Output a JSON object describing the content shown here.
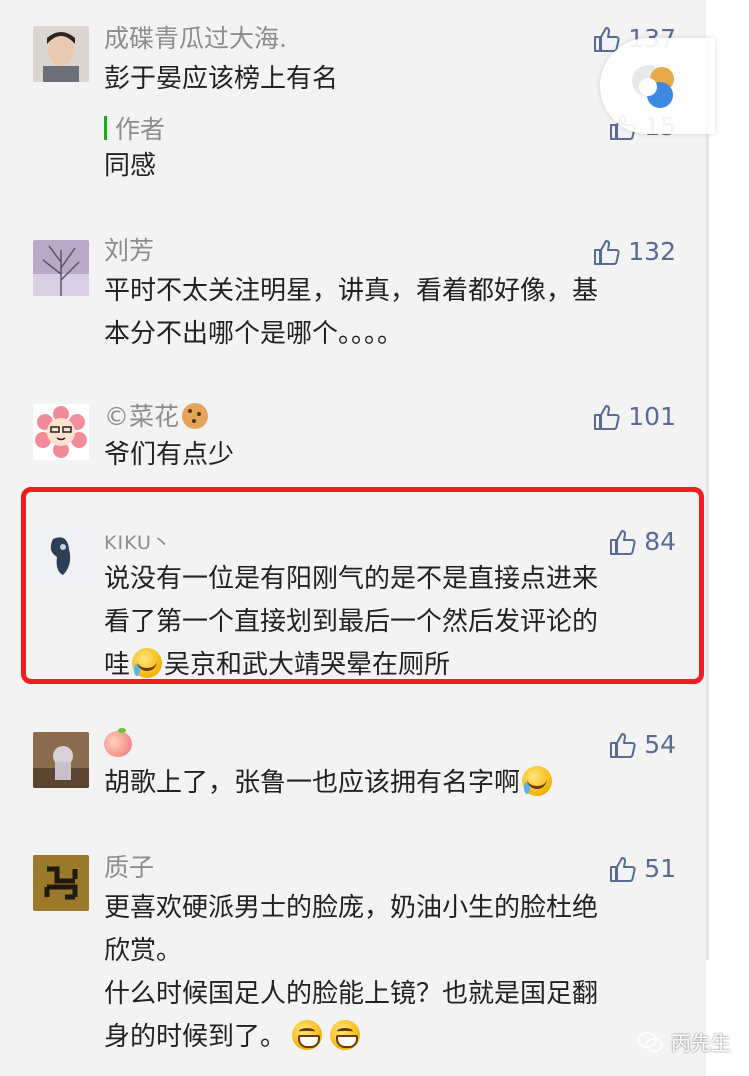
{
  "comments": [
    {
      "name": "成碟青瓜过大海.",
      "likes": "137",
      "lines": [
        "彭于晏应该榜上有名"
      ],
      "reply": {
        "author_label": "作者",
        "likes": "15",
        "text": "同感"
      }
    },
    {
      "name": "刘芳",
      "likes": "132",
      "lines": [
        "平时不太关注明星，讲真，看着都好像，基",
        "本分不出哪个是哪个。。。。"
      ]
    },
    {
      "name": "©菜花",
      "likes": "101",
      "lines": [
        "爷们有点少"
      ]
    },
    {
      "name": "KIKU丶",
      "likes": "84",
      "lines": [
        "说没有一位是有阳刚气的是不是直接点进来",
        "看了第一个直接划到最后一个然后发评论的",
        "哇",
        "吴京和武大靖哭晕在厕所"
      ]
    },
    {
      "name": "",
      "likes": "54",
      "lines": [
        "胡歌上了，张鲁一也应该拥有名字啊"
      ]
    },
    {
      "name": "质子",
      "likes": "51",
      "lines": [
        "更喜欢硬派男士的脸庞，奶油小生的脸杜绝",
        "欣赏。",
        "什么时候国足人的脸能上镜？也就是国足翻",
        "身的时候到了。"
      ]
    }
  ],
  "watermark": "丙先生",
  "colors": {
    "like": "#576b95",
    "highlight": "#ee1f1f",
    "author_bar": "#1aad19"
  }
}
